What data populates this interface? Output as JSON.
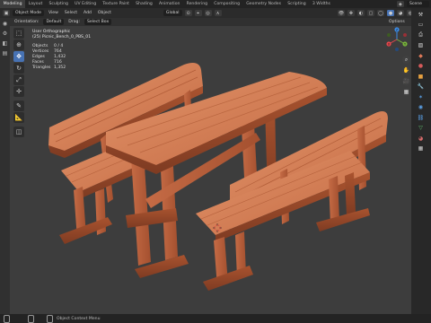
{
  "topbar": {
    "tabs": [
      {
        "label": "Modeling",
        "active": true
      },
      {
        "label": "Layout",
        "active": false
      },
      {
        "label": "Sculpting",
        "active": false
      },
      {
        "label": "UV Editing",
        "active": false
      },
      {
        "label": "Texture Paint",
        "active": false
      },
      {
        "label": "Shading",
        "active": false
      },
      {
        "label": "Animation",
        "active": false
      },
      {
        "label": "Rendering",
        "active": false
      },
      {
        "label": "Compositing",
        "active": false
      },
      {
        "label": "Geometry Nodes",
        "active": false
      },
      {
        "label": "Scripting",
        "active": false
      },
      {
        "label": "3 Widths",
        "active": false
      }
    ],
    "scene_label": "Scene"
  },
  "header": {
    "mode": "Object Mode",
    "menus": [
      "View",
      "Select",
      "Add",
      "Object"
    ],
    "orientation": "Global",
    "pivot_label": "",
    "header2": {
      "orientation_label": "Orientation:",
      "orientation_value": "Default",
      "drag_label": "Drag:",
      "drag_value": "Select Box"
    },
    "options_label": "Options"
  },
  "viewport": {
    "view_name": "User Orthographic",
    "object_name": "(25) Picnic_Bench_0_PBS_01",
    "stats": [
      {
        "label": "Objects",
        "value": "0 / 4"
      },
      {
        "label": "Vertices",
        "value": "764"
      },
      {
        "label": "Edges",
        "value": "1,432"
      },
      {
        "label": "Faces",
        "value": "716"
      },
      {
        "label": "Triangles",
        "value": "1,352"
      }
    ],
    "gizmo_axes": [
      "X",
      "Y",
      "Z"
    ]
  },
  "statusbar": {
    "text": "Object Context Menu"
  },
  "colors": {
    "accent": "#4772b3",
    "wood_light": "#d9865c",
    "wood_mid": "#c06a45",
    "wood_dark": "#8d4428",
    "axis_x": "#e6464c",
    "axis_y": "#78b43c",
    "axis_z": "#3c8ce6"
  }
}
